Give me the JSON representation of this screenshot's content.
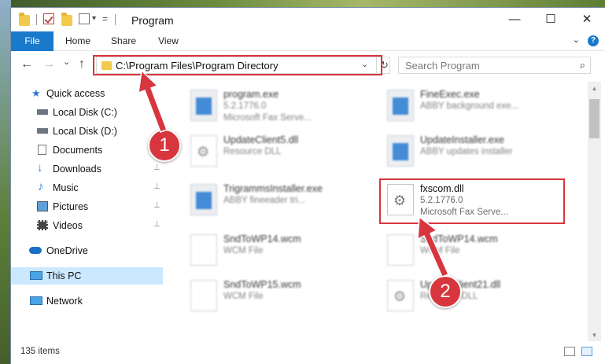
{
  "window": {
    "title": "Program",
    "minimize_glyph": "—",
    "maximize_glyph": "☐",
    "close_glyph": "✕"
  },
  "ribbon": {
    "tabs": [
      {
        "label": "File"
      },
      {
        "label": "Home"
      },
      {
        "label": "Share"
      },
      {
        "label": "View"
      }
    ],
    "collapse_glyph": "⌄",
    "help_glyph": "?"
  },
  "navbar": {
    "back_glyph": "←",
    "forward_glyph": "→",
    "recent_glyph": "⌄",
    "up_glyph": "↑",
    "address": "C:\\Program Files\\Program Directory",
    "address_drop_glyph": "⌄",
    "refresh_glyph": "↻",
    "search_placeholder": "Search Program",
    "search_glyph": "⌕"
  },
  "sidebar": {
    "items": [
      {
        "label": "Quick access",
        "icon": "star-icon",
        "pinned": false
      },
      {
        "label": "Local Disk (C:)",
        "icon": "drive-icon",
        "pinned": false
      },
      {
        "label": "Local Disk (D:)",
        "icon": "drive-icon",
        "pinned": false
      },
      {
        "label": "Documents",
        "icon": "documents-icon",
        "pinned": false
      },
      {
        "label": "Downloads",
        "icon": "download-icon",
        "pinned": true
      },
      {
        "label": "Music",
        "icon": "music-icon",
        "pinned": true
      },
      {
        "label": "Pictures",
        "icon": "pictures-icon",
        "pinned": true
      },
      {
        "label": "Videos",
        "icon": "videos-icon",
        "pinned": true
      },
      {
        "label": "OneDrive",
        "icon": "cloud-icon",
        "pinned": false
      },
      {
        "label": "This PC",
        "icon": "computer-icon",
        "pinned": false,
        "selected": true
      },
      {
        "label": "Network",
        "icon": "network-icon",
        "pinned": false
      }
    ],
    "pin_glyph": "📌"
  },
  "files": [
    {
      "name": "program.exe",
      "line2": "5.2.1776.0",
      "line3": "Microsoft Fax Serve...",
      "type": "exe"
    },
    {
      "name": "FineExec.exe",
      "line2": "ABBY background exe...",
      "line3": "",
      "type": "exe"
    },
    {
      "name": "UpdateClient5.dll",
      "line2": "Resource DLL",
      "line3": "",
      "type": "dll"
    },
    {
      "name": "UpdateInstaller.exe",
      "line2": "ABBY updates installer",
      "line3": "",
      "type": "exe"
    },
    {
      "name": "TrigrammsInstaller.exe",
      "line2": "ABBY fineeader tri...",
      "line3": "",
      "type": "exe"
    },
    {
      "name": "fxscom.dll",
      "line2": "5.2.1776.0",
      "line3": "Microsoft Fax Serve...",
      "type": "dll"
    },
    {
      "name": "SndToWP14.wcm",
      "line2": "WCM File",
      "line3": "",
      "type": "doc"
    },
    {
      "name": "SndToWP14.wcm",
      "line2": "WCM File",
      "line3": "",
      "type": "doc"
    },
    {
      "name": "SndToWP15.wcm",
      "line2": "WCM File",
      "line3": "",
      "type": "doc"
    },
    {
      "name": "UpdateClient21.dll",
      "line2": "Resource DLL",
      "line3": "",
      "type": "dll"
    }
  ],
  "status": {
    "item_count": "135 items"
  },
  "annotations": {
    "step1": "1",
    "step2": "2",
    "color": "#d8363f"
  }
}
